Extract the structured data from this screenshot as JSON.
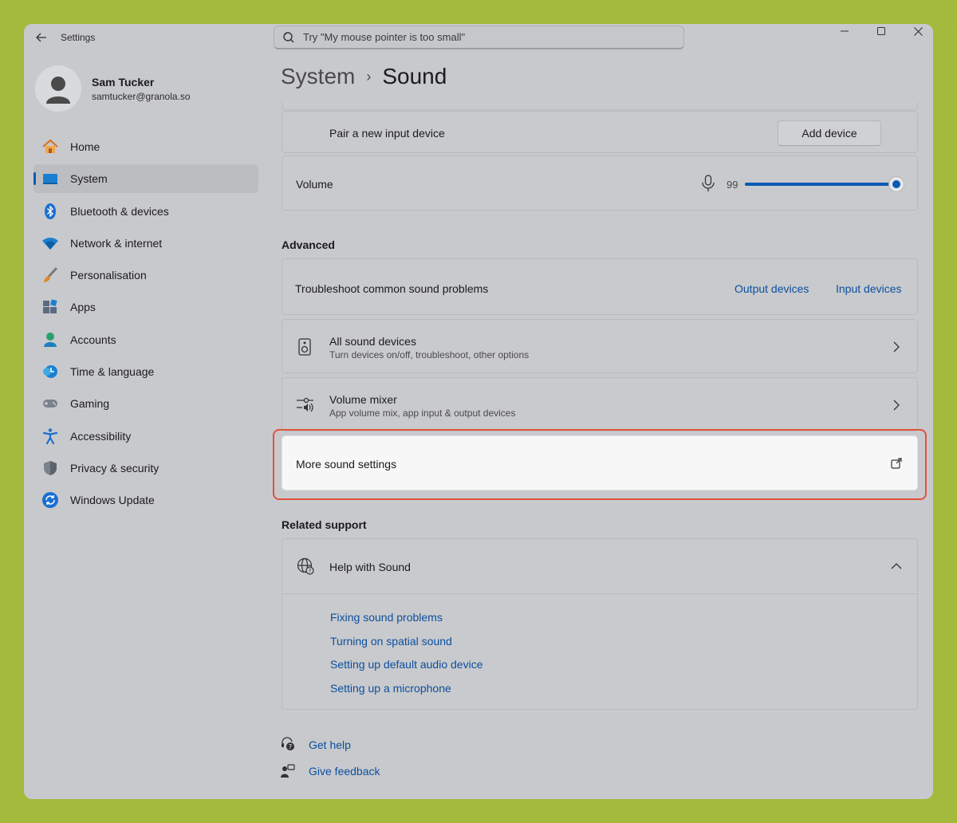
{
  "app": {
    "title": "Settings"
  },
  "search": {
    "placeholder": "Try \"My mouse pointer is too small\""
  },
  "user": {
    "name": "Sam Tucker",
    "email": "samtucker@granola.so"
  },
  "nav": {
    "items": [
      {
        "label": "Home",
        "icon": "home-icon",
        "active": false
      },
      {
        "label": "System",
        "icon": "system-icon",
        "active": true
      },
      {
        "label": "Bluetooth & devices",
        "icon": "bluetooth-icon",
        "active": false
      },
      {
        "label": "Network & internet",
        "icon": "wifi-icon",
        "active": false
      },
      {
        "label": "Personalisation",
        "icon": "brush-icon",
        "active": false
      },
      {
        "label": "Apps",
        "icon": "apps-icon",
        "active": false
      },
      {
        "label": "Accounts",
        "icon": "accounts-icon",
        "active": false
      },
      {
        "label": "Time & language",
        "icon": "time-language-icon",
        "active": false
      },
      {
        "label": "Gaming",
        "icon": "gamepad-icon",
        "active": false
      },
      {
        "label": "Accessibility",
        "icon": "accessibility-icon",
        "active": false
      },
      {
        "label": "Privacy & security",
        "icon": "shield-icon",
        "active": false
      },
      {
        "label": "Windows Update",
        "icon": "update-icon",
        "active": false
      }
    ]
  },
  "breadcrumb": {
    "parent": "System",
    "separator": "›",
    "current": "Sound"
  },
  "input": {
    "pair_label": "Pair a new input device",
    "add_button": "Add device",
    "volume_label": "Volume",
    "volume_value": "99",
    "volume_level": 0.99
  },
  "advanced": {
    "title": "Advanced",
    "troubleshoot_label": "Troubleshoot common sound problems",
    "output_link": "Output devices",
    "input_link": "Input devices",
    "all_devices_title": "All sound devices",
    "all_devices_sub": "Turn devices on/off, troubleshoot, other options",
    "mixer_title": "Volume mixer",
    "mixer_sub": "App volume mix, app input & output devices",
    "more_settings": "More sound settings"
  },
  "support": {
    "title": "Related support",
    "help_title": "Help with Sound",
    "links": [
      "Fixing sound problems",
      "Turning on spatial sound",
      "Setting up default audio device",
      "Setting up a microphone"
    ]
  },
  "footer": {
    "get_help": "Get help",
    "give_feedback": "Give feedback"
  },
  "colors": {
    "accent": "#0a5bb3",
    "link": "#0b4f9e",
    "highlight": "#e0533a",
    "background": "#a3ba3c"
  }
}
